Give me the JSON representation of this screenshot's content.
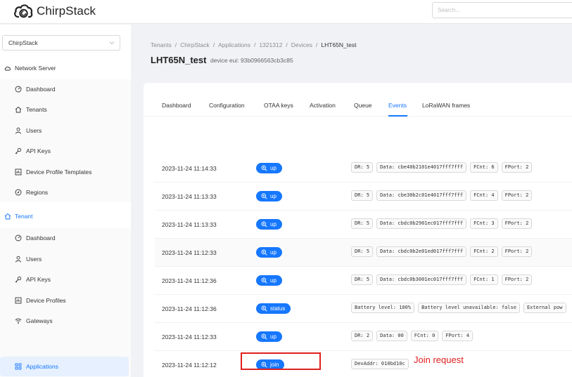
{
  "app": {
    "name": "ChirpStack"
  },
  "search": {
    "placeholder": "Search..."
  },
  "sidebar": {
    "tenant_select": "ChirpStack",
    "network_server": {
      "label": "Network Server",
      "items": [
        {
          "label": "Dashboard",
          "icon": "dashboard-icon"
        },
        {
          "label": "Tenants",
          "icon": "home-icon"
        },
        {
          "label": "Users",
          "icon": "user-icon"
        },
        {
          "label": "API Keys",
          "icon": "key-icon"
        },
        {
          "label": "Device Profile Templates",
          "icon": "template-icon"
        },
        {
          "label": "Regions",
          "icon": "compass-icon"
        }
      ]
    },
    "tenant": {
      "label": "Tenant",
      "items": [
        {
          "label": "Dashboard",
          "icon": "dashboard-icon"
        },
        {
          "label": "Users",
          "icon": "user-icon"
        },
        {
          "label": "API Keys",
          "icon": "key-icon"
        },
        {
          "label": "Device Profiles",
          "icon": "profile-icon"
        },
        {
          "label": "Gateways",
          "icon": "wifi-icon"
        },
        {
          "label": "Applications",
          "icon": "apps-icon",
          "selected": true
        }
      ]
    }
  },
  "breadcrumb": [
    "Tenants",
    "ChirpStack",
    "Applications",
    "1321312",
    "Devices",
    "LHT65N_test"
  ],
  "page": {
    "title": "LHT65N_test",
    "subtitle": "device eui: 93b0966563cb3c85"
  },
  "tabs": [
    {
      "label": "Dashboard"
    },
    {
      "label": "Configuration"
    },
    {
      "label": "OTAA keys"
    },
    {
      "label": "Activation"
    },
    {
      "label": "Queue"
    },
    {
      "label": "Events",
      "active": true
    },
    {
      "label": "LoRaWAN frames"
    }
  ],
  "events": [
    {
      "time": "2023-11-24 11:14:33",
      "type": "up",
      "fields": [
        "DR: 5",
        "Data: cbe40b2101e4017fff7fff",
        "FCnt: 6",
        "FPort: 2"
      ]
    },
    {
      "time": "2023-11-24 11:13:33",
      "type": "up",
      "fields": [
        "DR: 5",
        "Data: cbe30b2c01e4017fff7fff",
        "FCnt: 4",
        "FPort: 2"
      ]
    },
    {
      "time": "2023-11-24 11:13:33",
      "type": "up",
      "fields": [
        "DR: 5",
        "Data: cbdc0b2901ec017fff7fff",
        "FCnt: 3",
        "FPort: 2"
      ]
    },
    {
      "time": "2023-11-24 11:12:33",
      "type": "up",
      "fields": [
        "DR: 5",
        "Data: cbdc0b2e01ed017fff7fff",
        "FCnt: 2",
        "FPort: 2"
      ],
      "highlight": true
    },
    {
      "time": "2023-11-24 11:12:36",
      "type": "up",
      "fields": [
        "DR: 5",
        "Data: cbdc0b3001ec017fff7fff",
        "FCnt: 1",
        "FPort: 2"
      ]
    },
    {
      "time": "2023-11-24 11:12:36",
      "type": "status",
      "fields": [
        "Battery level: 100%",
        "Battery level unavailable: false",
        "External pow"
      ]
    },
    {
      "time": "2023-11-24 11:12:33",
      "type": "up",
      "fields": [
        "DR: 2",
        "Data: 00",
        "FCnt: 0",
        "FPort: 4"
      ]
    },
    {
      "time": "2023-11-24 11:12:12",
      "type": "join",
      "fields": [
        "DevAddr: 010bd10c"
      ]
    }
  ],
  "annotation": {
    "text": "Join request"
  },
  "colors": {
    "accent": "#1677ff",
    "annotation": "#e02020"
  }
}
